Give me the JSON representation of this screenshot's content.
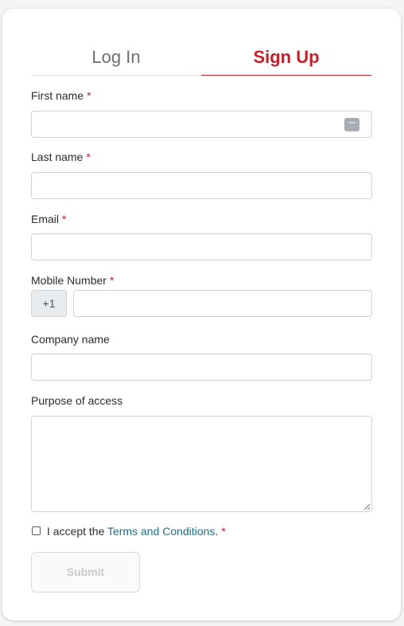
{
  "tabs": {
    "login": "Log In",
    "signup": "Sign Up"
  },
  "form": {
    "first_name_label": "First name",
    "last_name_label": "Last name",
    "email_label": "Email",
    "mobile_label": "Mobile Number",
    "country_code": "+1",
    "company_label": "Company name",
    "purpose_label": "Purpose of access",
    "required_mark": "*",
    "accept_prefix": "I accept the ",
    "terms_link": "Terms and Conditions",
    "accept_suffix": ".",
    "submit_label": "Submit"
  },
  "colors": {
    "accent": "#c0222b",
    "link": "#1a6f8a"
  },
  "icons": {
    "autofill": "password-manager-icon"
  }
}
